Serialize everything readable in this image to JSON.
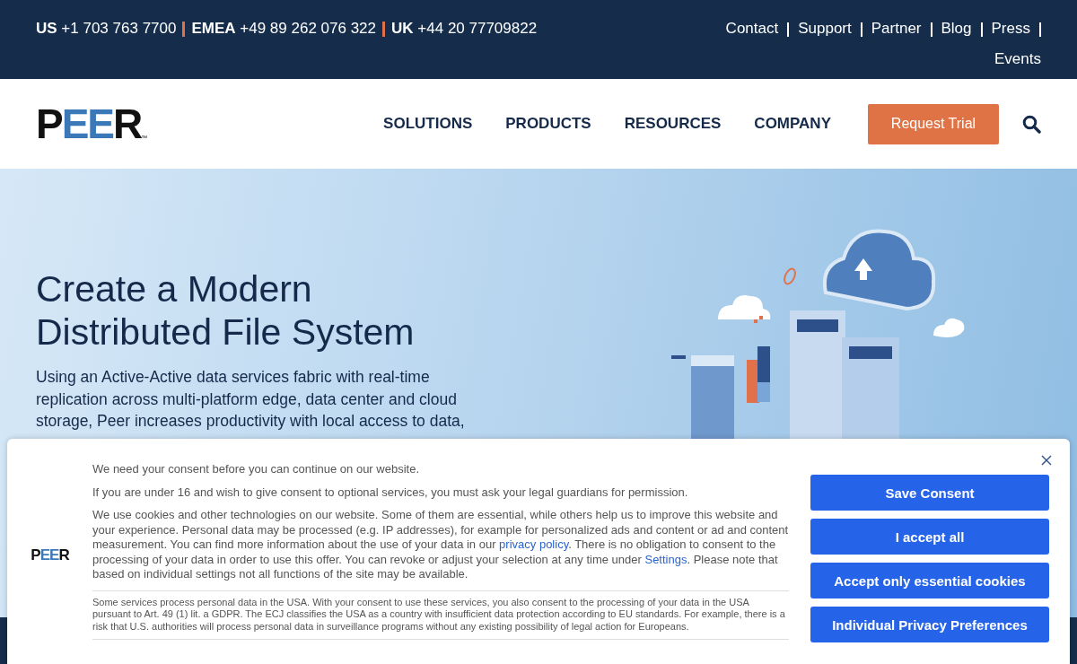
{
  "top_bar": {
    "phones": [
      {
        "region": "US",
        "number": "+1 703 763 7700"
      },
      {
        "region": "EMEA",
        "number": "+49 89 262 076 322"
      },
      {
        "region": "UK",
        "number": "+44 20 77709822"
      }
    ],
    "links": [
      "Contact",
      "Support",
      "Partner",
      "Blog",
      "Press",
      "Events"
    ]
  },
  "header": {
    "logo": {
      "text": "PEER",
      "mark": "™"
    },
    "nav": [
      "SOLUTIONS",
      "PRODUCTS",
      "RESOURCES",
      "COMPANY"
    ],
    "cta": "Request Trial"
  },
  "hero": {
    "title": "Create a Modern Distributed File System",
    "text": "Using an Active-Active data services fabric with real-time replication across multi-platform edge, data center and cloud storage, Peer increases productivity with local access to data,"
  },
  "consent": {
    "logo": "PEER",
    "paragraphs": [
      [
        {
          "kind": "text",
          "text": "We need your consent before you can continue on our website."
        }
      ],
      [
        {
          "kind": "text",
          "text": "If you are under 16 and wish to give consent to optional services, you must ask your legal guardians for permission."
        }
      ],
      [
        {
          "kind": "text",
          "text": "We use cookies and other technologies on our website. Some of them are essential, while others help us to improve this website and your experience. Personal data may be processed (e.g. IP addresses), for example for personalized ads and content or ad and content measurement. You can find more information about the use of your data in our "
        },
        {
          "kind": "link",
          "text": "privacy policy"
        },
        {
          "kind": "text",
          "text": ". There is no obligation to consent to the processing of your data in order to use this offer. You can revoke or adjust your selection at any time under "
        },
        {
          "kind": "link",
          "text": "Settings"
        },
        {
          "kind": "text",
          "text": ". Please note that based on individual settings not all functions of the site may be available."
        }
      ]
    ],
    "notice": "Some services process personal data in the USA. With your consent to use these services, you also consent to the processing of your data in the USA pursuant to Art. 49 (1) lit. a GDPR. The ECJ classifies the USA as a country with insufficient data protection according to EU standards. For example, there is a risk that U.S. authorities will process personal data in surveillance programs without any existing possibility of legal action for Europeans.",
    "buttons": [
      "Save Consent",
      "I accept all",
      "Accept only essential cookies",
      "Individual Privacy Preferences"
    ]
  }
}
